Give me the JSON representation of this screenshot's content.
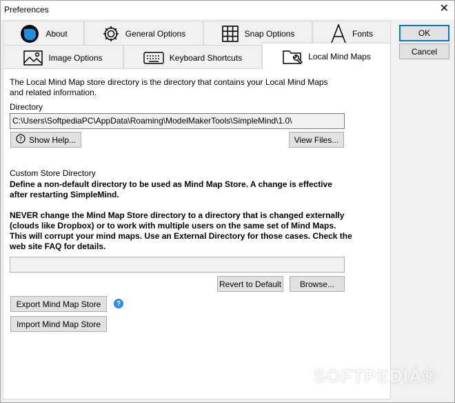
{
  "window": {
    "title": "Preferences"
  },
  "tabs_row1": [
    {
      "label": "About",
      "icon": "simplemind-logo-icon"
    },
    {
      "label": "General Options",
      "icon": "gear-icon"
    },
    {
      "label": "Snap Options",
      "icon": "grid-icon"
    },
    {
      "label": "Fonts",
      "icon": "font-icon"
    }
  ],
  "tabs_row2": [
    {
      "label": "Image Options",
      "icon": "image-icon"
    },
    {
      "label": "Keyboard Shortcuts",
      "icon": "keyboard-icon"
    },
    {
      "label": "Local Mind Maps",
      "icon": "folder-wrench-icon",
      "active": true
    }
  ],
  "dialog_buttons": {
    "ok": "OK",
    "cancel": "Cancel"
  },
  "content": {
    "intro_line1": "The Local Mind Map store directory is the directory that contains your Local Mind Maps",
    "intro_line2": "and related information.",
    "directory_label": "Directory",
    "directory_value": "C:\\Users\\SoftpediaPC\\AppData\\Roaming\\ModelMakerTools\\SimpleMind\\1.0\\",
    "show_help": "Show Help...",
    "view_files": "View Files...",
    "custom_label": "Custom Store Directory",
    "define_line1": "Define a non-default directory to be used as Mind Map Store. A change is effective",
    "define_line2": "after restarting SimpleMind.",
    "warn_line1": "NEVER change the Mind Map Store directory to a directory that is changed externally",
    "warn_line2": "(clouds like Dropbox) or to work with multiple users on the same set of Mind Maps.",
    "warn_line3": "This will corrupt your mind maps. Use an External Directory for those cases. Check the",
    "warn_line4": "web site FAQ for details.",
    "custom_value": "",
    "revert": "Revert to Default",
    "browse": "Browse...",
    "export": "Export Mind Map Store",
    "import": "Import Mind Map Store"
  },
  "colors": {
    "accent": "#0078d7",
    "help": "#2f8ef0",
    "logo": "#1f8fe0"
  }
}
